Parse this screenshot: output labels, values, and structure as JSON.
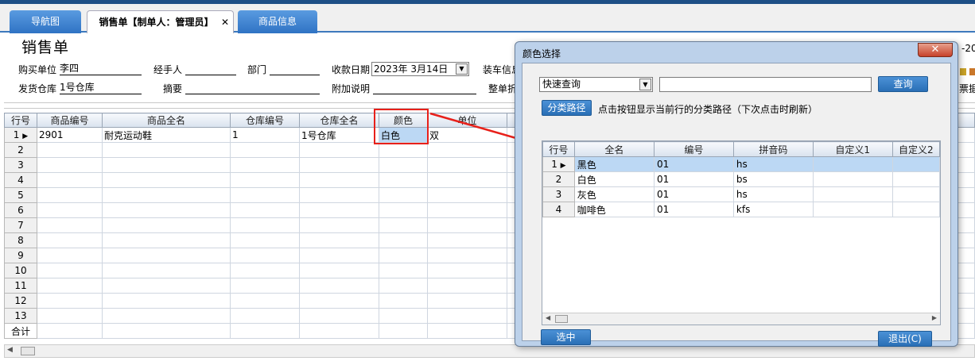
{
  "tabs": [
    {
      "label": "导航图"
    },
    {
      "label": "销售单【制单人：管理员】"
    },
    {
      "label": "商品信息"
    }
  ],
  "tab_close": "✕",
  "page_title": "销售单",
  "form": {
    "buyer_label": "购买单位",
    "buyer_value": "李四",
    "handler_label": "经手人",
    "dept_label": "部门",
    "date_label": "收款日期",
    "date_value": "2023年  3月14日",
    "loading_label": "装车信息",
    "warehouse_label": "发货仓库",
    "warehouse_value": "1号仓库",
    "summary_label": "摘要",
    "note_label": "附加说明",
    "discount_label": "整单折",
    "right_top_fragment": "-20",
    "right_bottom_fragment": "票据"
  },
  "main_grid": {
    "headers": [
      "行号",
      "商品编号",
      "商品全名",
      "仓库编号",
      "仓库全名",
      "颜色",
      "单位"
    ],
    "first_row": {
      "code": "2901",
      "name": "耐克运动鞋",
      "wh_code": "1",
      "wh_name": "1号仓库",
      "color": "白色",
      "unit": "双"
    },
    "row_numbers": [
      "1",
      "2",
      "3",
      "4",
      "5",
      "6",
      "7",
      "8",
      "9",
      "10",
      "11",
      "12",
      "13"
    ],
    "total_label": "合计"
  },
  "dialog": {
    "title": "颜色选择",
    "close": "✕",
    "search_mode": "快速查询",
    "search_button": "查询",
    "category_button": "分类路径",
    "category_hint": "点击按钮显示当前行的分类路径（下次点击时刷新）",
    "headers": [
      "行号",
      "全名",
      "编号",
      "拼音码",
      "自定义1",
      "自定义2"
    ],
    "rows": [
      {
        "no": "1",
        "name": "黑色",
        "code": "01",
        "py": "hs"
      },
      {
        "no": "2",
        "name": "白色",
        "code": "01",
        "py": "bs"
      },
      {
        "no": "3",
        "name": "灰色",
        "code": "01",
        "py": "hs"
      },
      {
        "no": "4",
        "name": "咖啡色",
        "code": "01",
        "py": "kfs"
      }
    ],
    "select_button": "选中",
    "exit_button": "退出(C)"
  },
  "colors": {
    "accent": "#2f73c4",
    "highlight": "#e8201a"
  }
}
